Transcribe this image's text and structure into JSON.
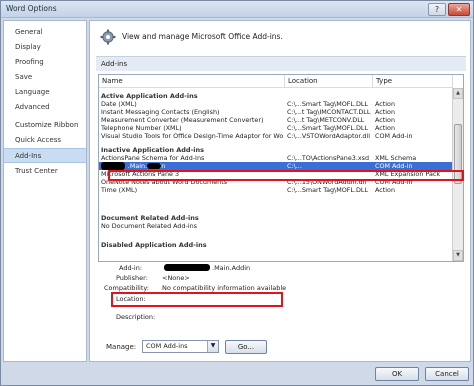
{
  "window": {
    "title": "Word Options",
    "help_glyph": "?",
    "close_glyph": "✕"
  },
  "sidebar": {
    "items": [
      {
        "label": "General"
      },
      {
        "label": "Display"
      },
      {
        "label": "Proofing"
      },
      {
        "label": "Save"
      },
      {
        "label": "Language"
      },
      {
        "label": "Advanced"
      },
      {
        "label": "Customize Ribbon"
      },
      {
        "label": "Quick Access Toolbar"
      },
      {
        "label": "Add-Ins",
        "active": true
      },
      {
        "label": "Trust Center"
      }
    ]
  },
  "header": {
    "text": "View and manage Microsoft Office Add-ins.",
    "icon": "addins-gear-icon"
  },
  "section": {
    "label": "Add-ins"
  },
  "table": {
    "columns": [
      "Name",
      "Location",
      "Type"
    ],
    "groups": [
      {
        "label": "Active Application Add-ins",
        "rows": [
          {
            "name": "Date (XML)",
            "location": "C:\\...Smart Tag\\MOFL.DLL",
            "type": "Action"
          },
          {
            "name": "Instant Messaging Contacts (English)",
            "location": "C:\\...t Tag\\IMCONTACT.DLL",
            "type": "Action"
          },
          {
            "name": "Measurement Converter (Measurement Converter)",
            "location": "C:\\...t Tag\\METCONV.DLL",
            "type": "Action"
          },
          {
            "name": "Telephone Number (XML)",
            "location": "C:\\...Smart Tag\\MOFL.DLL",
            "type": "Action"
          },
          {
            "name": "Visual Studio Tools for Office Design-Time Adaptor for Word",
            "location": "C:\\...VSTOWordAdaptor.dll",
            "type": "COM Add-in"
          }
        ]
      },
      {
        "label": "Inactive Application Add-ins",
        "rows": [
          {
            "name": "ActionsPane Schema for Add-Ins",
            "location": "C:\\...TO\\ActionsPane3.xsd",
            "type": "XML Schema"
          },
          {
            "name": ".Office2 .Main.Addin",
            "location": "C:\\...",
            "type": "COM Add-in",
            "selected": true
          },
          {
            "name": "Microsoft Actions Pane 3",
            "location": "",
            "type": "XML Expansion Pack"
          },
          {
            "name": "OneNote Notes about Word Documents",
            "location": "C:\\...15\\ONWordAddin.dll",
            "type": "COM Add-in"
          },
          {
            "name": "Time (XML)",
            "location": "C:\\...Smart Tag\\MOFL.DLL",
            "type": "Action"
          }
        ]
      },
      {
        "label": "Document Related Add-ins",
        "rows": [
          {
            "name": "No Document Related Add-ins",
            "location": "",
            "type": ""
          }
        ]
      },
      {
        "label": "Disabled Application Add-ins",
        "rows": []
      }
    ]
  },
  "details": {
    "addin_label": "Add-in:",
    "addin_value": ".Main.Addin",
    "publisher_label": "Publisher:",
    "publisher_value": "<None>",
    "compat_label": "Compatibility:",
    "compat_value": "No compatibility information available",
    "location_label": "Location:",
    "location_value": "",
    "description_label": "Description:",
    "description_value": ""
  },
  "manage": {
    "label": "Manage:",
    "selected": "COM Add-ins",
    "go_label": "Go..."
  },
  "buttons": {
    "ok": "OK",
    "cancel": "Cancel"
  },
  "colors": {
    "highlight_box": "#e3131b",
    "selection": "#3b6fd6"
  }
}
